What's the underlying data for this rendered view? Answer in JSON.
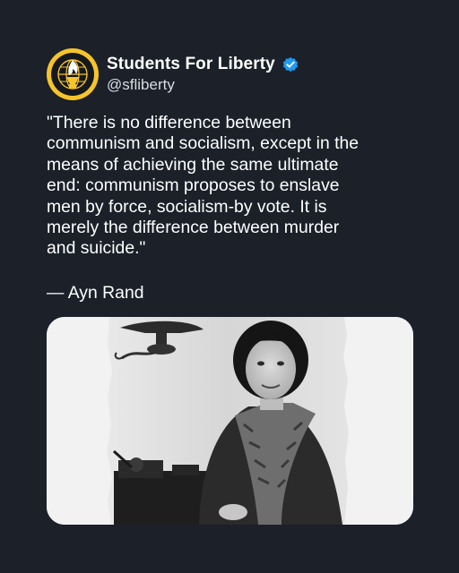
{
  "account": {
    "display_name": "Students For Liberty",
    "handle": "@sfliberty",
    "verified": true,
    "avatar_icon": "torch-logo-icon",
    "verified_icon": "verified-badge-icon",
    "colors": {
      "background": "#1b2029",
      "logo_gold": "#f6c42a",
      "verified_blue": "#1d9bf0"
    }
  },
  "post": {
    "quote_lines": [
      "\"There is no difference between",
      "communism and socialism, except in the",
      "means of achieving the same ultimate",
      "end: communism proposes to enslave",
      "men by force, socialism-by vote. It is",
      "merely the difference between murder",
      "and suicide.\""
    ],
    "attribution": "— Ayn Rand"
  },
  "image": {
    "subject": "black-and-white-portrait-photo"
  }
}
